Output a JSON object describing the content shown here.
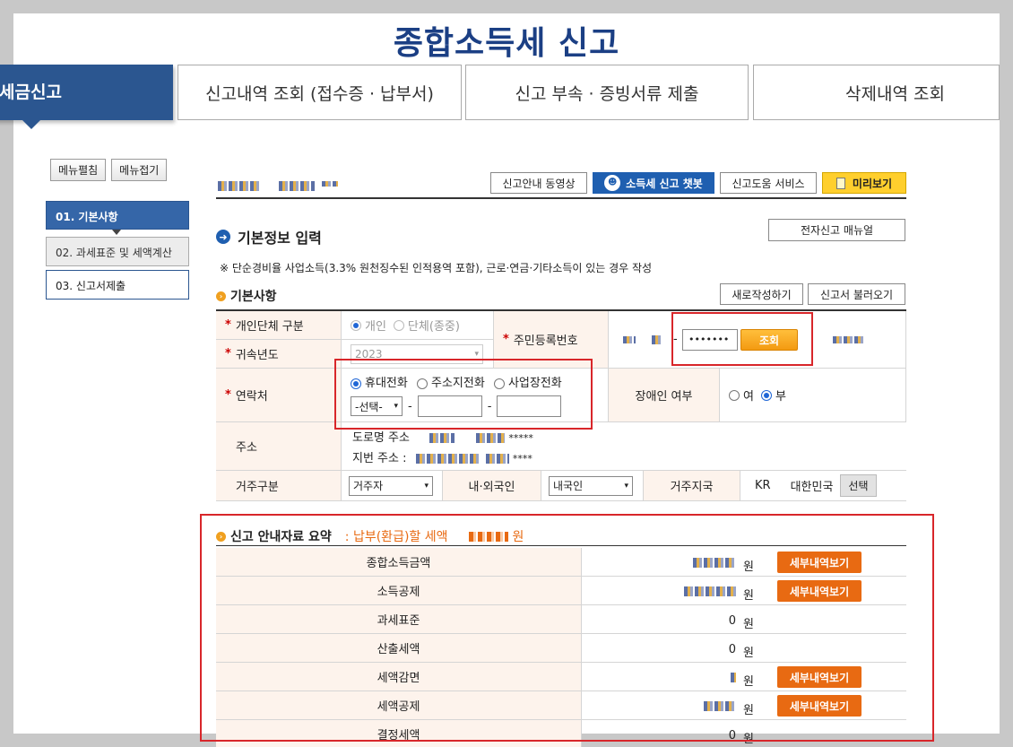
{
  "page_title": "종합소득세 신고",
  "tabs": {
    "active": "세금신고",
    "items": [
      "신고내역 조회 (접수증 · 납부서)",
      "신고 부속 · 증빙서류 제출",
      "삭제내역 조회"
    ]
  },
  "sidebar": {
    "expand": "메뉴펼침",
    "collapse": "메뉴접기",
    "steps": [
      "01. 기본사항",
      "02. 과세표준 및 세액계산",
      "03. 신고서제출"
    ]
  },
  "toolbar": {
    "video": "신고안내 동영상",
    "chatbot": "소득세 신고 챗봇",
    "help": "신고도움 서비스",
    "preview": "미리보기"
  },
  "section": {
    "title": "기본정보 입력",
    "manual_btn": "전자신고 매뉴얼",
    "note": "※ 단순경비율 사업소득(3.3% 원천징수된 인적용역 포함), 근로·연금·기타소득이 있는 경우 작성",
    "sub_title": "기본사항",
    "new_btn": "새로작성하기",
    "load_btn": "신고서 불러오기"
  },
  "form": {
    "type_label": "개인단체 구분",
    "type_opt1": "개인",
    "type_opt2": "단체(종중)",
    "year_label": "귀속년도",
    "year_value": "2023",
    "rrn_label": "주민등록번호",
    "rrn_masked": "•••••••",
    "rrn_dash": "-",
    "lookup_btn": "조회",
    "contact_label": "연락처",
    "phone_opt1": "휴대전화",
    "phone_opt2": "주소지전화",
    "phone_opt3": "사업장전화",
    "phone_select": "-선택-",
    "dash": "-",
    "disabled_label": "장애인 여부",
    "disabled_yes": "여",
    "disabled_no": "부",
    "address_label": "주소",
    "road_address": "도로명 주소",
    "road_tail": "*****",
    "lot_address": "지번 주소 :",
    "lot_tail": "****",
    "residence_label": "거주구분",
    "residence_value": "거주자",
    "nationality_label": "내·외국인",
    "nationality_value": "내국인",
    "country_label": "거주지국",
    "country_code": "KR",
    "country_name": "대한민국",
    "select_btn": "선택"
  },
  "summary": {
    "title": "신고 안내자료 요약",
    "pay_label": ": 납부(환급)할 세액",
    "won": "원",
    "detail_btn": "세부내역보기",
    "rows": [
      {
        "label": "종합소득금액",
        "amount": "",
        "has_btn": true
      },
      {
        "label": "소득공제",
        "amount": "",
        "has_btn": true
      },
      {
        "label": "과세표준",
        "amount": "0",
        "has_btn": false
      },
      {
        "label": "산출세액",
        "amount": "0",
        "has_btn": false
      },
      {
        "label": "세액감면",
        "amount": "",
        "has_btn": true
      },
      {
        "label": "세액공제",
        "amount": "",
        "has_btn": true
      },
      {
        "label": "결정세액",
        "amount": "0",
        "has_btn": false
      }
    ]
  },
  "colors": {
    "brand": "#2b5690",
    "title": "#1b3f84",
    "accent": "#e86a12",
    "highlight": "#d8262a"
  }
}
